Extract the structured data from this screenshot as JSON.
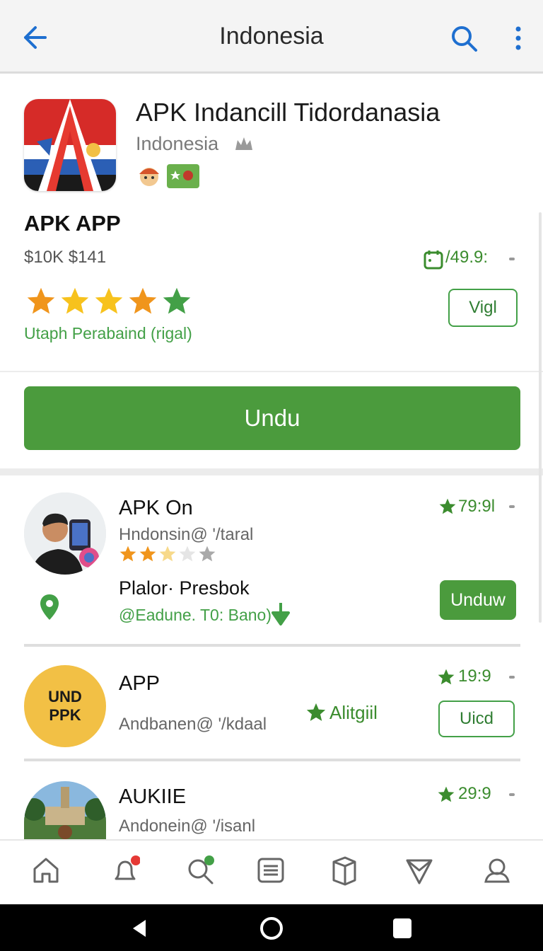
{
  "appbar": {
    "title": "Indonesia",
    "back_icon": "arrow-back-icon",
    "search_icon": "search-icon",
    "more_icon": "more-vert-icon"
  },
  "hero": {
    "title": "APK Indancill Tidordanasia",
    "subtitle": "Indonesia",
    "app_label": "APK APP",
    "price": "$10K $141",
    "date_text": "/49.9:",
    "stars": 5,
    "rating_caption": "Utaph Perabaind (rigal)",
    "side_button": "Vigl"
  },
  "download": {
    "label": "Undu"
  },
  "list": [
    {
      "title": "APK On",
      "subtitle": "Hndonsin@ '/taral",
      "rating": "79:9l",
      "stars": 2.5,
      "place_name": "Plalor· Presbok",
      "place_line": "@Eadune. T0: Bano)",
      "button": "Unduw"
    },
    {
      "title": "APP",
      "subtitle": "Andbanen@ '/kdaal",
      "rating": "19:9",
      "avatar_line1": "UND",
      "avatar_line2": "PPK",
      "mid_rating": "Alitgiil",
      "button": "Uicd"
    },
    {
      "title": "AUKIIE",
      "subtitle": "Andonein@ '/isanl",
      "rating": "29:9"
    }
  ],
  "bottom_nav": [
    "home-icon",
    "notifications-icon",
    "search-icon",
    "list-icon",
    "box-icon",
    "send-icon",
    "profile-icon"
  ],
  "colors": {
    "accent": "#4b9b3d",
    "accent_text": "#3b8c2e",
    "star_orange": "#f0951c",
    "star_yellow": "#f7c21d",
    "blue": "#1e6fd0"
  }
}
